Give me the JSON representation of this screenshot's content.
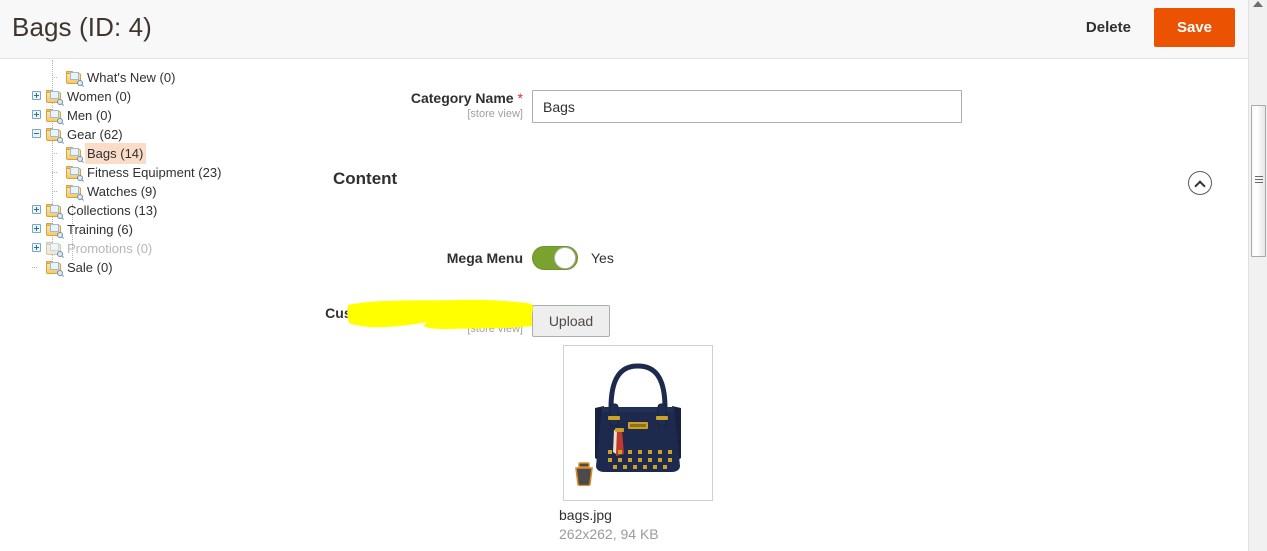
{
  "header": {
    "title": "Bags (ID: 4)",
    "delete_label": "Delete",
    "save_label": "Save",
    "save_color": "#eb5202"
  },
  "tree": {
    "nodes": [
      {
        "label": "What's New (0)",
        "indent": 2,
        "toggle": "none",
        "selected": false,
        "dim": false
      },
      {
        "label": "Women (0)",
        "indent": 1,
        "toggle": "plus",
        "selected": false,
        "dim": false
      },
      {
        "label": "Men (0)",
        "indent": 1,
        "toggle": "plus",
        "selected": false,
        "dim": false
      },
      {
        "label": "Gear (62)",
        "indent": 1,
        "toggle": "minus",
        "selected": false,
        "dim": false
      },
      {
        "label": "Bags (14)",
        "indent": 2,
        "toggle": "none",
        "selected": true,
        "dim": false
      },
      {
        "label": "Fitness Equipment (23)",
        "indent": 2,
        "toggle": "none",
        "selected": false,
        "dim": false
      },
      {
        "label": "Watches (9)",
        "indent": 2,
        "toggle": "none",
        "selected": false,
        "dim": false
      },
      {
        "label": "Collections (13)",
        "indent": 1,
        "toggle": "plus",
        "selected": false,
        "dim": false
      },
      {
        "label": "Training (6)",
        "indent": 1,
        "toggle": "plus",
        "selected": false,
        "dim": false
      },
      {
        "label": "Promotions (0)",
        "indent": 1,
        "toggle": "plus",
        "selected": false,
        "dim": true
      },
      {
        "label": "Sale (0)",
        "indent": 1,
        "toggle": "none",
        "selected": false,
        "dim": false
      }
    ],
    "selected_highlight_color": "#fbdcc8"
  },
  "form": {
    "category_name": {
      "label": "Category Name",
      "required_marker": "*",
      "scope": "[store view]",
      "value": "Bags",
      "placeholder": ""
    },
    "section": {
      "title": "Content",
      "collapse_icon": "chevron-up-icon"
    },
    "mega_menu": {
      "label": "Mega Menu",
      "state_text": "Yes",
      "enabled": true,
      "on_color": "#79a22e"
    },
    "custom_image": {
      "label": "Custom Image for Mobile App",
      "scope": "[store view]",
      "highlighted": true,
      "highlight_color": "#ffff00",
      "upload_label": "Upload",
      "file_name": "bags.jpg",
      "file_meta": "262x262, 94 KB",
      "delete_icon": "trash-icon",
      "image_alt": "navy handbag"
    }
  },
  "scrollbar": {
    "up_arrow_icon": "scroll-up-arrow-icon",
    "grip_icon": "scrollbar-grip-icon"
  }
}
